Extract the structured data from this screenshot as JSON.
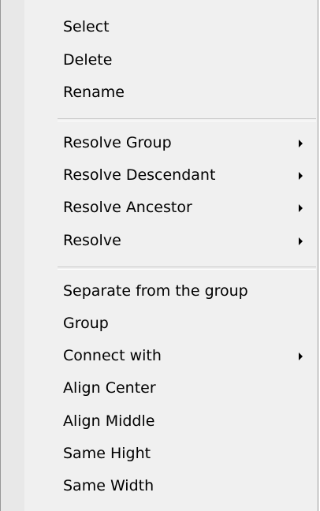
{
  "context_menu": {
    "groups": [
      {
        "items": [
          {
            "label": "Select"
          },
          {
            "label": "Delete"
          },
          {
            "label": "Rename"
          }
        ]
      },
      {
        "items": [
          {
            "label": "Resolve Group",
            "submenu_icon": "submenu-arrow-icon"
          },
          {
            "label": "Resolve Descendant",
            "submenu_icon": "submenu-arrow-icon"
          },
          {
            "label": "Resolve Ancestor",
            "submenu_icon": "submenu-arrow-icon"
          },
          {
            "label": "Resolve",
            "submenu_icon": "submenu-arrow-icon"
          }
        ]
      },
      {
        "items": [
          {
            "label": "Separate from the group"
          },
          {
            "label": "Group"
          },
          {
            "label": "Connect with",
            "submenu_icon": "submenu-arrow-icon"
          },
          {
            "label": "Align Center"
          },
          {
            "label": "Align Middle"
          },
          {
            "label": "Same Hight"
          },
          {
            "label": "Same Width"
          }
        ]
      }
    ]
  }
}
